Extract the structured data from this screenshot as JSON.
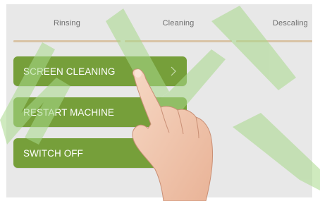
{
  "tabs": [
    {
      "label": "Rinsing"
    },
    {
      "label": "Cleaning"
    },
    {
      "label": "Descaling"
    }
  ],
  "menu": [
    {
      "label": "SCREEN CLEANING",
      "icon": "chevron-right-icon"
    },
    {
      "label": "RESTART MACHINE",
      "icon": "chevron-right-icon"
    },
    {
      "label": "SWITCH OFF"
    }
  ],
  "watermark": {
    "text": "MUI"
  },
  "colors": {
    "screen_bg": "#e8e8e8",
    "button_green": "#769f3a",
    "tab_underline": "#d9c3a6",
    "tab_text": "#6e6e6e",
    "watermark_green": "#a8d98a"
  }
}
